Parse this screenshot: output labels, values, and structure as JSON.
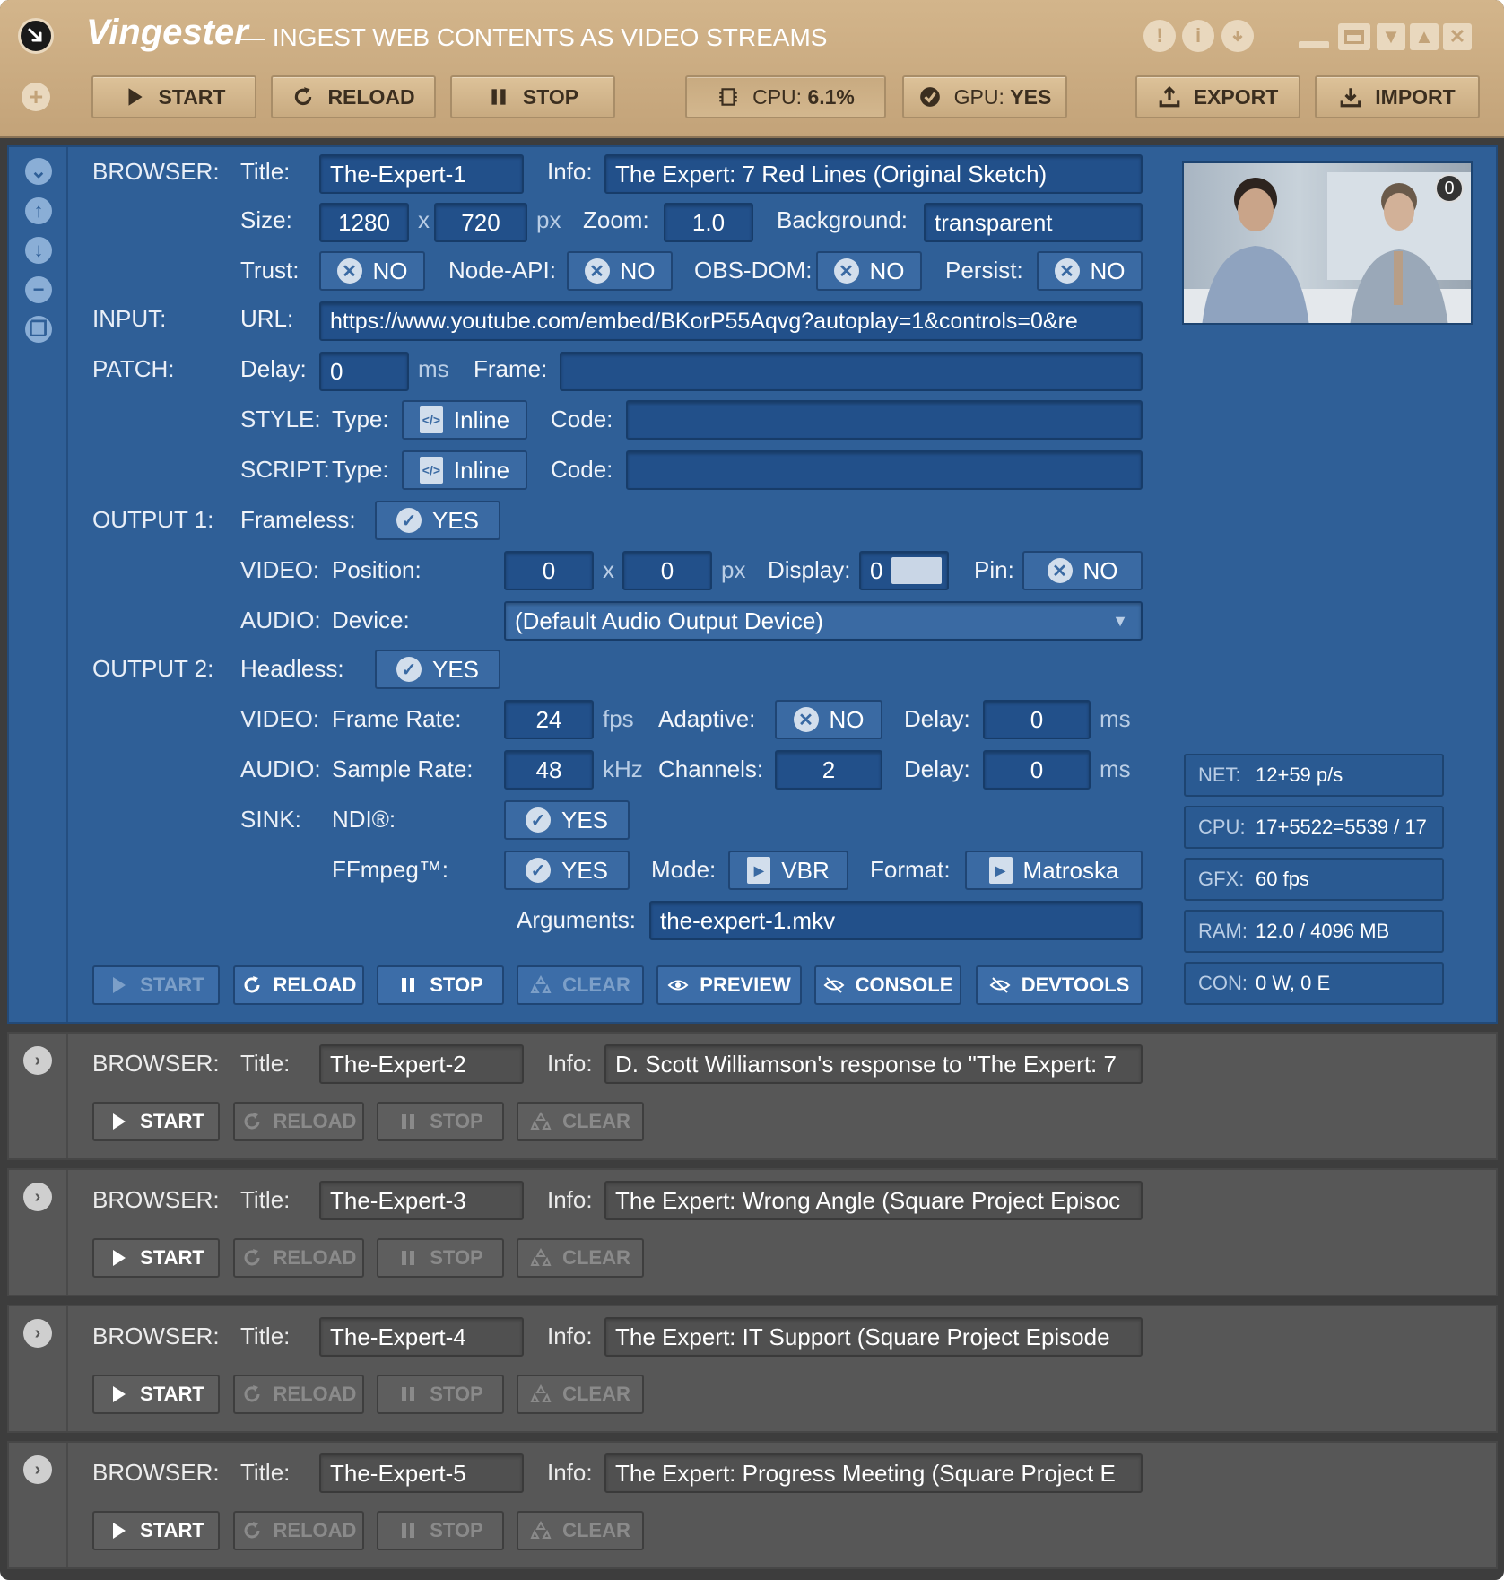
{
  "app": {
    "name": "Vingester",
    "subtitle": "— INGEST WEB CONTENTS AS VIDEO STREAMS"
  },
  "toolbar": {
    "start": "START",
    "reload": "RELOAD",
    "stop": "STOP",
    "cpu_label": "CPU:",
    "cpu_value": "6.1%",
    "gpu_label": "GPU:",
    "gpu_value": "YES",
    "export": "EXPORT",
    "import": "IMPORT"
  },
  "colors": {
    "titlebar": "#c9ab80",
    "active_panel": "#2f5f97",
    "inactive_panel": "#575757"
  },
  "browser1": {
    "section_browser": "BROWSER:",
    "title_label": "Title:",
    "title": "The-Expert-1",
    "info_label": "Info:",
    "info": "The Expert: 7 Red Lines (Original Sketch)",
    "size_label": "Size:",
    "width": "1280",
    "x": "x",
    "height": "720",
    "px": "px",
    "zoom_label": "Zoom:",
    "zoom": "1.0",
    "background_label": "Background:",
    "background": "transparent",
    "trust_label": "Trust:",
    "trust": "NO",
    "nodeapi_label": "Node-API:",
    "nodeapi": "NO",
    "obsdom_label": "OBS-DOM:",
    "obsdom": "NO",
    "persist_label": "Persist:",
    "persist": "NO",
    "section_input": "INPUT:",
    "url_label": "URL:",
    "url": "https://www.youtube.com/embed/BKorP55Aqvg?autoplay=1&controls=0&re",
    "section_patch": "PATCH:",
    "delay_label": "Delay:",
    "delay": "0",
    "ms": "ms",
    "frame_label": "Frame:",
    "frame": "",
    "style_label": "STYLE:",
    "type_label": "Type:",
    "style_type": "Inline",
    "code_label": "Code:",
    "style_code": "",
    "script_label": "SCRIPT:",
    "script_type": "Inline",
    "script_code": "",
    "section_output1": "OUTPUT 1:",
    "frameless_label": "Frameless:",
    "frameless": "YES",
    "video_label": "VIDEO:",
    "position_label": "Position:",
    "pos_x": "0",
    "pos_y": "0",
    "display_label": "Display:",
    "display": "0",
    "pin_label": "Pin:",
    "pin": "NO",
    "audio_label": "AUDIO:",
    "device_label": "Device:",
    "device": "(Default Audio Output Device)",
    "section_output2": "OUTPUT 2:",
    "headless_label": "Headless:",
    "headless": "YES",
    "framerate_label": "Frame Rate:",
    "framerate": "24",
    "fps": "fps",
    "adaptive_label": "Adaptive:",
    "adaptive": "NO",
    "vdelay_label": "Delay:",
    "vdelay": "0",
    "samplerate_label": "Sample Rate:",
    "samplerate": "48",
    "khz": "kHz",
    "channels_label": "Channels:",
    "channels": "2",
    "adelay_label": "Delay:",
    "adelay": "0",
    "sink_label": "SINK:",
    "ndi_label": "NDI®:",
    "ndi": "YES",
    "ffmpeg_label": "FFmpeg™:",
    "ffmpeg": "YES",
    "mode_label": "Mode:",
    "mode": "VBR",
    "format_label": "Format:",
    "format": "Matroska",
    "arguments_label": "Arguments:",
    "arguments": "the-expert-1.mkv",
    "preview_badge": "0",
    "buttons": {
      "start": "START",
      "reload": "RELOAD",
      "stop": "STOP",
      "clear": "CLEAR",
      "preview": "PREVIEW",
      "console": "CONSOLE",
      "devtools": "DEVTOOLS"
    },
    "stats": [
      {
        "k": "NET:",
        "v": "12+59 p/s"
      },
      {
        "k": "CPU:",
        "v": "17+5522=5539 / 17"
      },
      {
        "k": "GFX:",
        "v": "60 fps"
      },
      {
        "k": "RAM:",
        "v": "12.0 / 4096 MB"
      },
      {
        "k": "CON:",
        "v": "0 W, 0 E"
      }
    ]
  },
  "browsers": [
    {
      "section": "BROWSER:",
      "title_label": "Title:",
      "title": "The-Expert-2",
      "info_label": "Info:",
      "info": "D. Scott Williamson's response to \"The Expert: 7",
      "start": "START",
      "reload": "RELOAD",
      "stop": "STOP",
      "clear": "CLEAR"
    },
    {
      "section": "BROWSER:",
      "title_label": "Title:",
      "title": "The-Expert-3",
      "info_label": "Info:",
      "info": "The Expert: Wrong Angle (Square Project Episoc",
      "start": "START",
      "reload": "RELOAD",
      "stop": "STOP",
      "clear": "CLEAR"
    },
    {
      "section": "BROWSER:",
      "title_label": "Title:",
      "title": "The-Expert-4",
      "info_label": "Info:",
      "info": "The Expert: IT Support (Square Project Episode",
      "start": "START",
      "reload": "RELOAD",
      "stop": "STOP",
      "clear": "CLEAR"
    },
    {
      "section": "BROWSER:",
      "title_label": "Title:",
      "title": "The-Expert-5",
      "info_label": "Info:",
      "info": "The Expert: Progress Meeting (Square Project E",
      "start": "START",
      "reload": "RELOAD",
      "stop": "STOP",
      "clear": "CLEAR"
    }
  ]
}
